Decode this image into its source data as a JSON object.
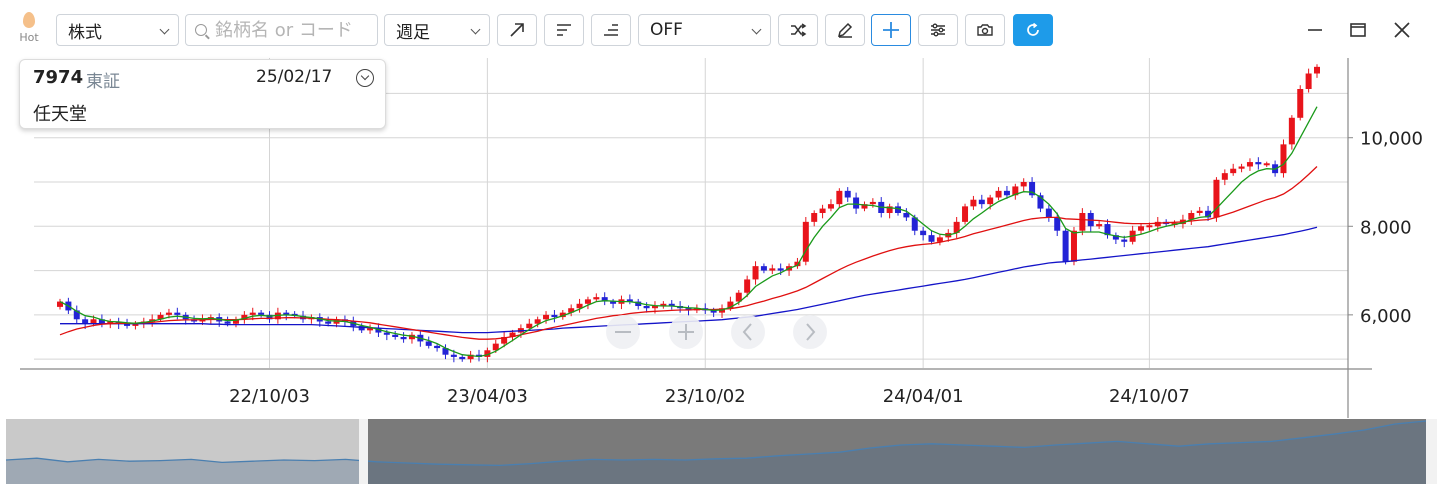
{
  "toolbar": {
    "hot_label": "Hot",
    "market_select": "株式",
    "search_placeholder": "銘柄名 or コード",
    "period_select": "週足",
    "indicator_select": "OFF"
  },
  "info": {
    "code": "7974",
    "exchange": "東証",
    "date": "25/02/17",
    "name": "任天堂"
  },
  "colors": {
    "up": "#e8141b",
    "down": "#2323d6",
    "ma_short": "#1a9a1a",
    "ma_mid": "#e01010",
    "ma_long": "#1414c8",
    "accent": "#1e9be9"
  },
  "chart_data": {
    "type": "candlestick",
    "title": "",
    "y_ticks": [
      6000,
      8000,
      10000
    ],
    "y_tick_labels": [
      "6,000",
      "8,000",
      "10,000"
    ],
    "ylim": [
      4800,
      11800
    ],
    "x_tick_labels": [
      "22/10/03",
      "23/04/03",
      "23/10/02",
      "24/04/01",
      "24/10/07"
    ],
    "x_tick_index": [
      25,
      51,
      77,
      103,
      130
    ],
    "grid": true,
    "close": [
      6300,
      6100,
      5900,
      5800,
      5900,
      5800,
      5850,
      5800,
      5750,
      5800,
      5850,
      5900,
      6000,
      6050,
      6000,
      5900,
      5850,
      5900,
      5950,
      5850,
      5800,
      5900,
      6000,
      6050,
      6000,
      5900,
      6050,
      6000,
      5980,
      5900,
      5950,
      5850,
      5800,
      5900,
      5850,
      5750,
      5650,
      5700,
      5600,
      5550,
      5500,
      5450,
      5550,
      5400,
      5300,
      5250,
      5100,
      5050,
      5000,
      5100,
      5050,
      5200,
      5350,
      5500,
      5600,
      5700,
      5800,
      5900,
      6000,
      5950,
      6050,
      6150,
      6250,
      6350,
      6400,
      6300,
      6250,
      6350,
      6300,
      6200,
      6150,
      6200,
      6250,
      6200,
      6150,
      6100,
      6150,
      6100,
      6050,
      6150,
      6300,
      6500,
      6800,
      7100,
      7000,
      7050,
      7000,
      7100,
      7200,
      8100,
      8300,
      8400,
      8500,
      8800,
      8650,
      8400,
      8500,
      8550,
      8300,
      8450,
      8300,
      8200,
      7900,
      7800,
      7650,
      7750,
      7850,
      8100,
      8450,
      8600,
      8500,
      8650,
      8800,
      8700,
      8900,
      9000,
      8700,
      8400,
      8200,
      7900,
      7200,
      7900,
      8300,
      8000,
      8050,
      7800,
      7700,
      7650,
      7900,
      8000,
      8000,
      8100,
      8050,
      8050,
      8150,
      8300,
      8350,
      8200,
      9050,
      9200,
      9300,
      9350,
      9450,
      9400,
      9400,
      9200,
      9850,
      10450,
      11100,
      11450,
      11600
    ],
    "ma_short": [
      6300,
      6200,
      6080,
      5980,
      5950,
      5890,
      5850,
      5840,
      5820,
      5810,
      5830,
      5860,
      5900,
      5950,
      5970,
      5950,
      5920,
      5910,
      5920,
      5900,
      5870,
      5880,
      5920,
      5970,
      5990,
      5970,
      5990,
      6000,
      5990,
      5960,
      5940,
      5910,
      5870,
      5860,
      5850,
      5810,
      5760,
      5720,
      5670,
      5620,
      5580,
      5540,
      5520,
      5470,
      5420,
      5350,
      5250,
      5170,
      5100,
      5080,
      5060,
      5100,
      5180,
      5300,
      5420,
      5550,
      5670,
      5780,
      5870,
      5920,
      5980,
      6050,
      6130,
      6220,
      6300,
      6320,
      6310,
      6300,
      6300,
      6270,
      6230,
      6210,
      6200,
      6200,
      6180,
      6160,
      6150,
      6120,
      6100,
      6110,
      6170,
      6280,
      6440,
      6640,
      6760,
      6880,
      6950,
      7050,
      7120,
      7450,
      7750,
      8000,
      8200,
      8420,
      8500,
      8500,
      8480,
      8470,
      8430,
      8420,
      8400,
      8340,
      8200,
      8050,
      7900,
      7820,
      7800,
      7850,
      8000,
      8170,
      8300,
      8440,
      8560,
      8640,
      8720,
      8780,
      8770,
      8660,
      8500,
      8280,
      7950,
      7850,
      7870,
      7870,
      7870,
      7820,
      7780,
      7750,
      7780,
      7820,
      7880,
      7950,
      8000,
      8040,
      8080,
      8150,
      8200,
      8220,
      8400,
      8600,
      8800,
      9000,
      9150,
      9250,
      9300,
      9290,
      9400,
      9650,
      10000,
      10350,
      10700
    ],
    "ma_mid": [
      5550,
      5620,
      5680,
      5720,
      5760,
      5790,
      5800,
      5810,
      5810,
      5815,
      5820,
      5830,
      5850,
      5870,
      5880,
      5885,
      5885,
      5890,
      5895,
      5895,
      5890,
      5890,
      5900,
      5910,
      5920,
      5920,
      5930,
      5935,
      5935,
      5930,
      5925,
      5915,
      5900,
      5890,
      5880,
      5860,
      5840,
      5820,
      5790,
      5760,
      5730,
      5700,
      5670,
      5640,
      5610,
      5580,
      5550,
      5520,
      5490,
      5470,
      5450,
      5450,
      5460,
      5480,
      5510,
      5550,
      5590,
      5630,
      5680,
      5720,
      5760,
      5800,
      5840,
      5880,
      5920,
      5950,
      5980,
      6000,
      6030,
      6050,
      6070,
      6080,
      6090,
      6100,
      6110,
      6110,
      6120,
      6120,
      6120,
      6130,
      6140,
      6170,
      6210,
      6260,
      6310,
      6370,
      6420,
      6480,
      6540,
      6620,
      6720,
      6820,
      6920,
      7020,
      7110,
      7190,
      7260,
      7330,
      7390,
      7450,
      7500,
      7540,
      7570,
      7590,
      7610,
      7640,
      7680,
      7720,
      7770,
      7830,
      7880,
      7930,
      7980,
      8030,
      8080,
      8130,
      8170,
      8190,
      8200,
      8200,
      8170,
      8160,
      8150,
      8140,
      8130,
      8110,
      8090,
      8070,
      8060,
      8060,
      8060,
      8070,
      8080,
      8090,
      8100,
      8120,
      8140,
      8150,
      8200,
      8260,
      8320,
      8390,
      8460,
      8530,
      8600,
      8650,
      8730,
      8850,
      9000,
      9170,
      9350
    ],
    "ma_long": [
      5800,
      5800,
      5800,
      5800,
      5800,
      5800,
      5800,
      5800,
      5800,
      5800,
      5800,
      5800,
      5800,
      5800,
      5800,
      5800,
      5800,
      5800,
      5790,
      5790,
      5780,
      5780,
      5780,
      5780,
      5780,
      5780,
      5780,
      5780,
      5780,
      5780,
      5780,
      5770,
      5760,
      5750,
      5740,
      5730,
      5720,
      5710,
      5700,
      5690,
      5680,
      5670,
      5660,
      5650,
      5640,
      5630,
      5620,
      5610,
      5600,
      5600,
      5600,
      5600,
      5610,
      5620,
      5630,
      5640,
      5650,
      5660,
      5670,
      5680,
      5700,
      5710,
      5720,
      5730,
      5740,
      5750,
      5760,
      5770,
      5780,
      5790,
      5800,
      5810,
      5820,
      5830,
      5840,
      5850,
      5860,
      5870,
      5880,
      5890,
      5910,
      5930,
      5950,
      5970,
      6000,
      6030,
      6060,
      6090,
      6120,
      6160,
      6200,
      6240,
      6280,
      6320,
      6360,
      6400,
      6440,
      6470,
      6500,
      6530,
      6560,
      6590,
      6620,
      6650,
      6680,
      6710,
      6740,
      6770,
      6800,
      6840,
      6880,
      6920,
      6960,
      7000,
      7040,
      7080,
      7110,
      7140,
      7170,
      7190,
      7200,
      7220,
      7240,
      7260,
      7280,
      7300,
      7320,
      7340,
      7360,
      7380,
      7400,
      7420,
      7440,
      7460,
      7480,
      7500,
      7520,
      7540,
      7570,
      7600,
      7630,
      7660,
      7690,
      7720,
      7750,
      7780,
      7810,
      7850,
      7890,
      7930,
      7980
    ]
  },
  "navigator": {
    "series": [
      0.35,
      0.38,
      0.32,
      0.36,
      0.33,
      0.34,
      0.36,
      0.31,
      0.33,
      0.35,
      0.34,
      0.36,
      0.32,
      0.3,
      0.28,
      0.27,
      0.26,
      0.29,
      0.33,
      0.36,
      0.35,
      0.36,
      0.35,
      0.37,
      0.38,
      0.42,
      0.45,
      0.48,
      0.55,
      0.6,
      0.62,
      0.6,
      0.58,
      0.56,
      0.6,
      0.63,
      0.66,
      0.62,
      0.58,
      0.62,
      0.64,
      0.66,
      0.72,
      0.78,
      0.85,
      0.95,
      1.0
    ]
  }
}
